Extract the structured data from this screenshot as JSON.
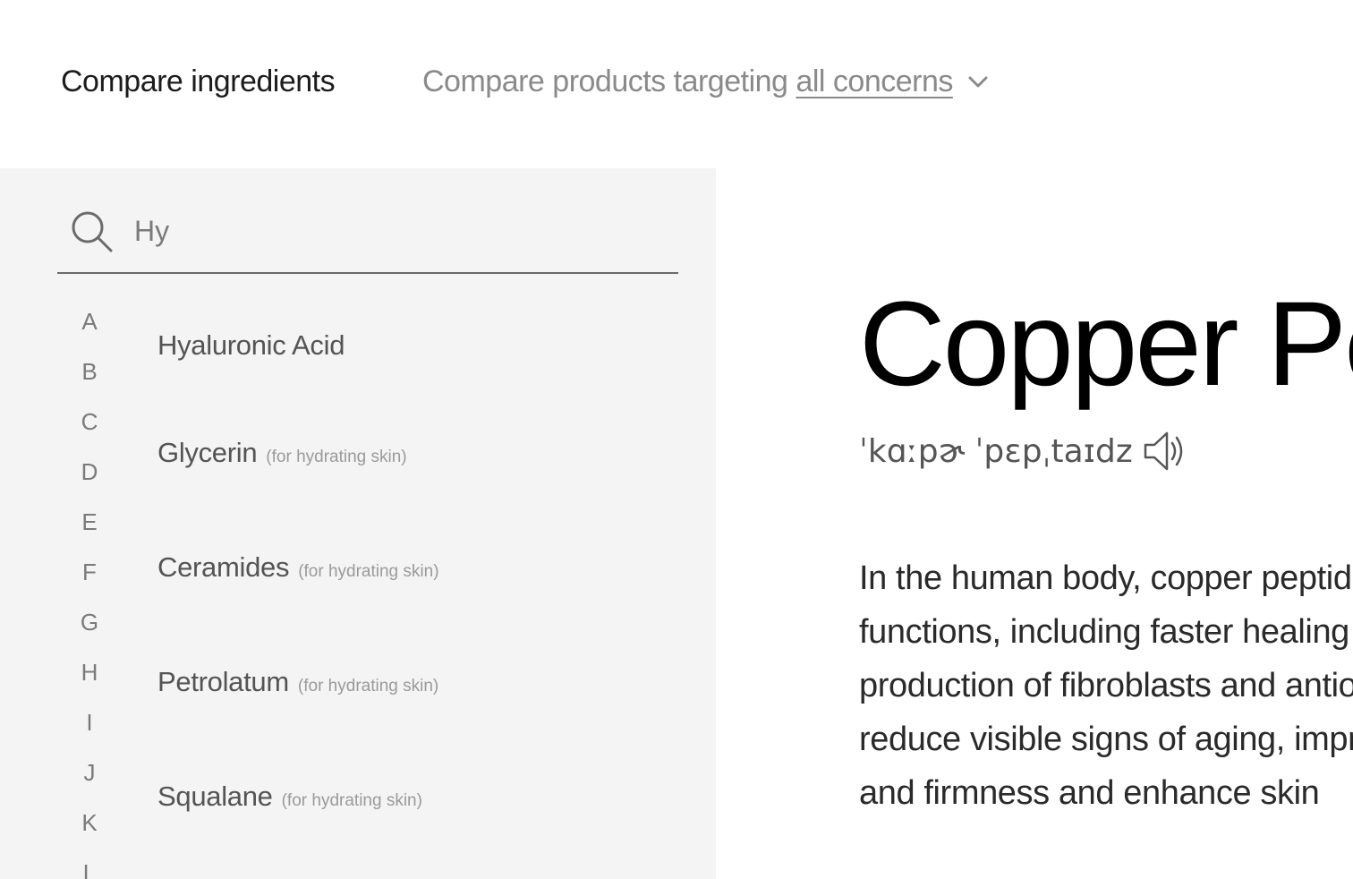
{
  "header": {
    "compare_ingredients": "Compare ingredients",
    "compare_products_prefix": "Compare products targeting",
    "concern_link": "all concerns"
  },
  "search": {
    "value": "Hy"
  },
  "alphabet": [
    "A",
    "B",
    "C",
    "D",
    "E",
    "F",
    "G",
    "H",
    "I",
    "J",
    "K",
    "L"
  ],
  "results": [
    {
      "name": "Hyaluronic Acid",
      "tag": ""
    },
    {
      "name": "Glycerin",
      "tag": "(for hydrating skin)"
    },
    {
      "name": "Ceramides",
      "tag": "(for hydrating skin)"
    },
    {
      "name": "Petrolatum",
      "tag": "(for hydrating skin)"
    },
    {
      "name": "Squalane",
      "tag": "(for hydrating skin)"
    }
  ],
  "detail": {
    "title": "Copper Peptides",
    "pronunciation": "ˈkɑːpɚ ˈpɛpˌtaɪdz",
    "description_lines": [
      "In the human body, copper peptides support several functions,",
      "functions, including faster healing of wounds and the",
      "production of fibroblasts and antioxidants. They may help",
      "reduce visible signs of aging, improve skin elasticity",
      "and firmness and enhance skin"
    ]
  }
}
